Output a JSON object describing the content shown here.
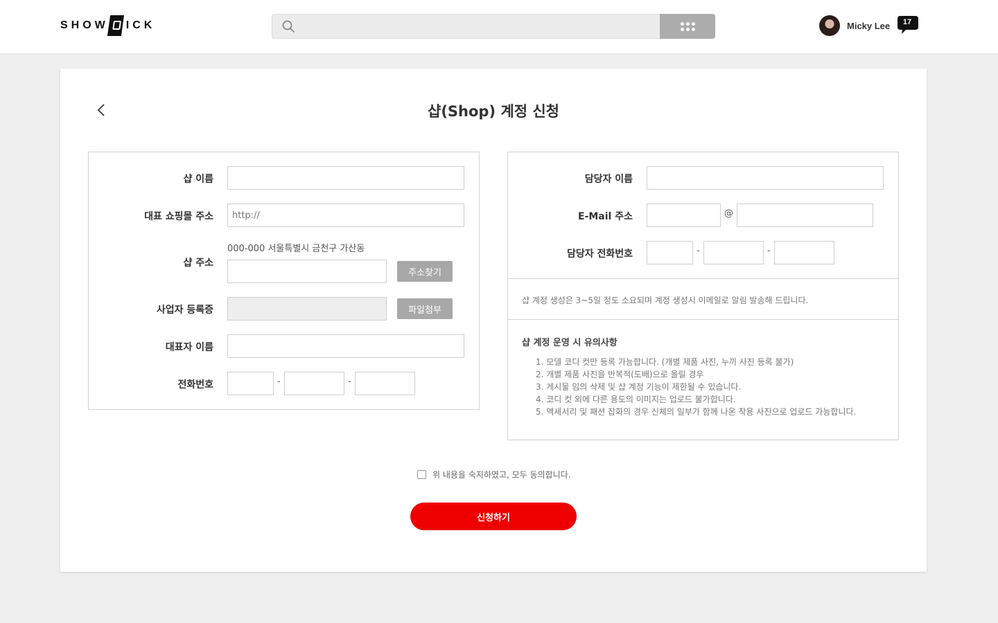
{
  "brand": {
    "logo_left": "SHOW",
    "logo_right": "ICK",
    "accent": "#ef0000"
  },
  "header": {
    "search_placeholder": "",
    "user_name": "Micky Lee",
    "notification_count": "17"
  },
  "page": {
    "title": "샵(Shop) 계정 신청"
  },
  "shop_form": {
    "shop_name_label": "샵 이름",
    "mall_url_label": "대표 쇼핑몰 주소",
    "mall_url_placeholder": "http://",
    "shop_address_label": "샵 주소",
    "address_text": "000-000 서울특별시 금천구 가산동",
    "find_address_button": "주소찾기",
    "business_license_label": "사업자 등록증",
    "attach_file_button": "파일첨부",
    "ceo_name_label": "대표자 이름",
    "phone_label": "전화번호",
    "dash": "-"
  },
  "contact_form": {
    "manager_name_label": "담당자 이름",
    "email_label": "E-Mail 주소",
    "at_sign": "@",
    "manager_phone_label": "담당자 전화번호",
    "dash": "-",
    "notice": "샵 계정 생성은 3~5일 정도 소요되며 계정 생성시 이메일로 알림 발송해 드립니다.",
    "caution_title": "샵 계정 운영 시 유의사항",
    "cautions": [
      "1.  모델 코디 컷만 등록 가능합니다. (개별 제품 사진, 누끼 사진 등록 불가)",
      "2.  개별 제품 사진을 반복적(도배)으로 올릴 경우",
      "3.  게시물 임의 삭제 및 샵 계정 기능이 제한될 수 있습니다.",
      "4.  코디 컷 외에 다른 용도의 이미지는 업로드 불가합니다.",
      "5.  액세서리 및 패션 잡화의 경우 신체의 일부가 함께 나온 착용 사진으로 업로드 가능합니다."
    ]
  },
  "agreement": {
    "text": "위 내용을 숙지하였고, 모두 동의합니다."
  },
  "submit": {
    "label": "신청하기"
  }
}
